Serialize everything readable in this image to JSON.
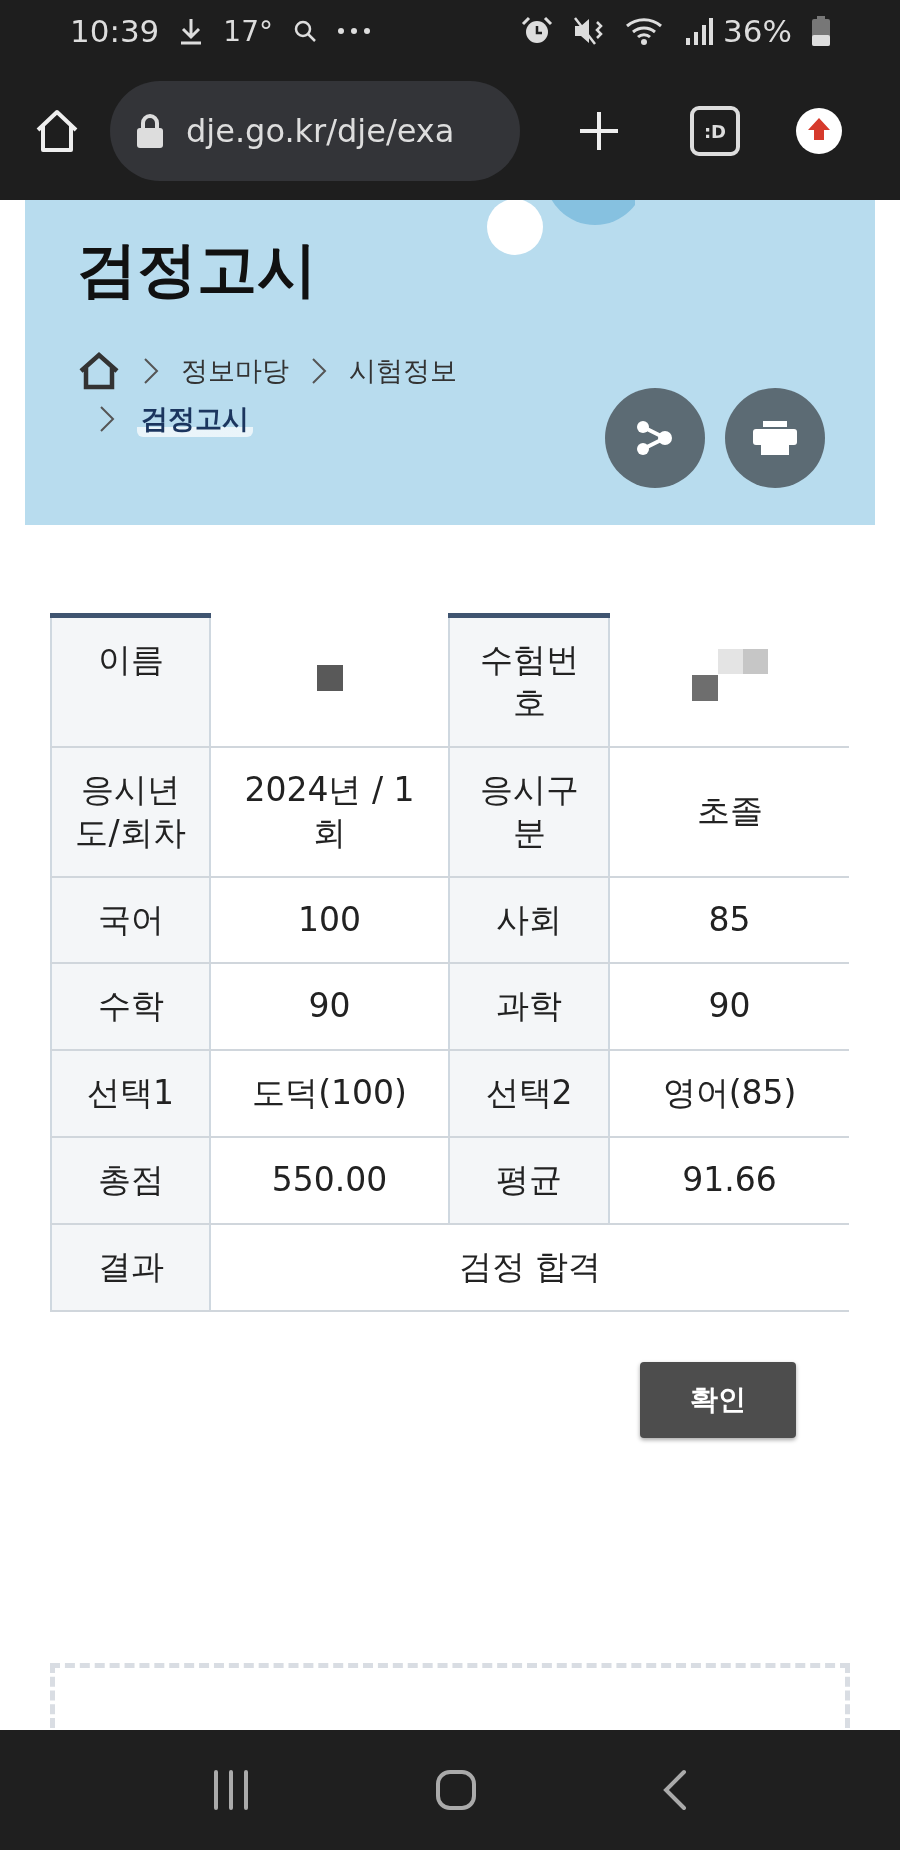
{
  "status_bar": {
    "time": "10:39",
    "temperature": "17°",
    "battery": "36%"
  },
  "browser": {
    "url": "dje.go.kr/dje/exa",
    "tab_button": ":D"
  },
  "banner": {
    "title": "검정고시",
    "breadcrumb": [
      {
        "label": "정보마당",
        "current": false
      },
      {
        "label": "시험정보",
        "current": false
      },
      {
        "label": "검정고시",
        "current": true
      }
    ]
  },
  "table": {
    "rows": [
      {
        "cells": [
          {
            "kind": "label",
            "text": "이름"
          },
          {
            "kind": "redacted"
          },
          {
            "kind": "label",
            "text": "수험번호"
          },
          {
            "kind": "redacted"
          }
        ]
      },
      {
        "cells": [
          {
            "kind": "label",
            "text": "응시년도/회차"
          },
          {
            "kind": "value",
            "text": "2024년 / 1회"
          },
          {
            "kind": "label",
            "text": "응시구분"
          },
          {
            "kind": "value",
            "text": "초졸"
          }
        ]
      },
      {
        "cells": [
          {
            "kind": "label",
            "text": "국어"
          },
          {
            "kind": "value",
            "text": "100"
          },
          {
            "kind": "label",
            "text": "사회"
          },
          {
            "kind": "value",
            "text": "85"
          }
        ]
      },
      {
        "cells": [
          {
            "kind": "label",
            "text": "수학"
          },
          {
            "kind": "value",
            "text": "90"
          },
          {
            "kind": "label",
            "text": "과학"
          },
          {
            "kind": "value",
            "text": "90"
          }
        ]
      },
      {
        "cells": [
          {
            "kind": "label",
            "text": "선택1"
          },
          {
            "kind": "value",
            "text": "도덕(100)"
          },
          {
            "kind": "label",
            "text": "선택2"
          },
          {
            "kind": "value",
            "text": "영어(85)"
          }
        ]
      },
      {
        "cells": [
          {
            "kind": "label",
            "text": "총점"
          },
          {
            "kind": "value",
            "text": "550.00"
          },
          {
            "kind": "label",
            "text": "평균"
          },
          {
            "kind": "value",
            "text": "91.66"
          }
        ]
      },
      {
        "cells": [
          {
            "kind": "label",
            "text": "결과"
          },
          {
            "kind": "value",
            "text": "검정 합격",
            "colspan": 3
          }
        ]
      }
    ]
  },
  "confirm_button": "확인"
}
